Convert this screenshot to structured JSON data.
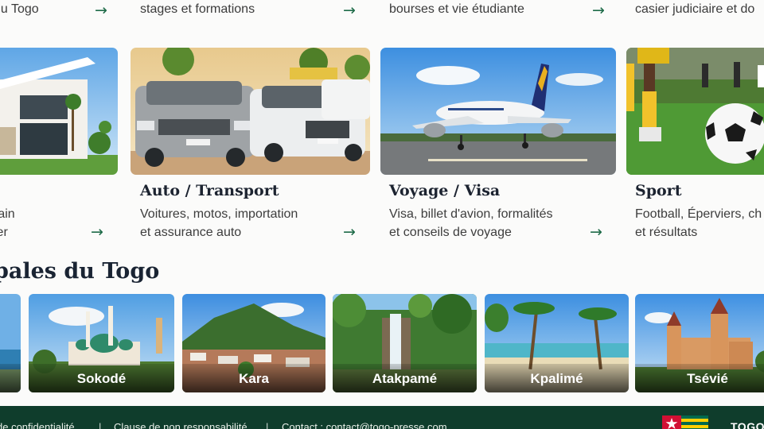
{
  "top_row": {
    "items": [
      {
        "line2": "du Togo"
      },
      {
        "line2": "stages et formations"
      },
      {
        "line2": "bourses et vie étudiante"
      },
      {
        "line2": "casier judiciaire et do"
      }
    ],
    "arrow_glyph": "→"
  },
  "cards": [
    {
      "title": "",
      "desc1": "rain",
      "desc2": "ier",
      "image": "modern-house"
    },
    {
      "title": "Auto / Transport",
      "desc1": "Voitures, motos, importation",
      "desc2": "et assurance auto",
      "image": "suv-cars"
    },
    {
      "title": "Voyage / Visa",
      "desc1": "Visa, billet d'avion, formalités",
      "desc2": "et conseils de voyage",
      "image": "airplane"
    },
    {
      "title": "Sport",
      "desc1": "Football, Éperviers, ch",
      "desc2": "et résultats",
      "image": "football"
    }
  ],
  "section": {
    "title": "pales du Togo"
  },
  "cities": [
    {
      "name": ""
    },
    {
      "name": "Sokodé"
    },
    {
      "name": "Kara"
    },
    {
      "name": "Atakpamé"
    },
    {
      "name": "Kpalimé"
    },
    {
      "name": "Tsévié"
    }
  ],
  "footer": {
    "privacy": "de confidentialité",
    "disclaimer": "Clause de non responsabilité",
    "contact": "Contact : contact@togo-presse.com",
    "separator": "|",
    "brand": "TOGO"
  },
  "colors": {
    "accent_green": "#1e6b48",
    "footer_bg": "#0f3d2c",
    "flag_green": "#006a4e",
    "flag_yellow": "#ffce00",
    "flag_red": "#d21034"
  }
}
